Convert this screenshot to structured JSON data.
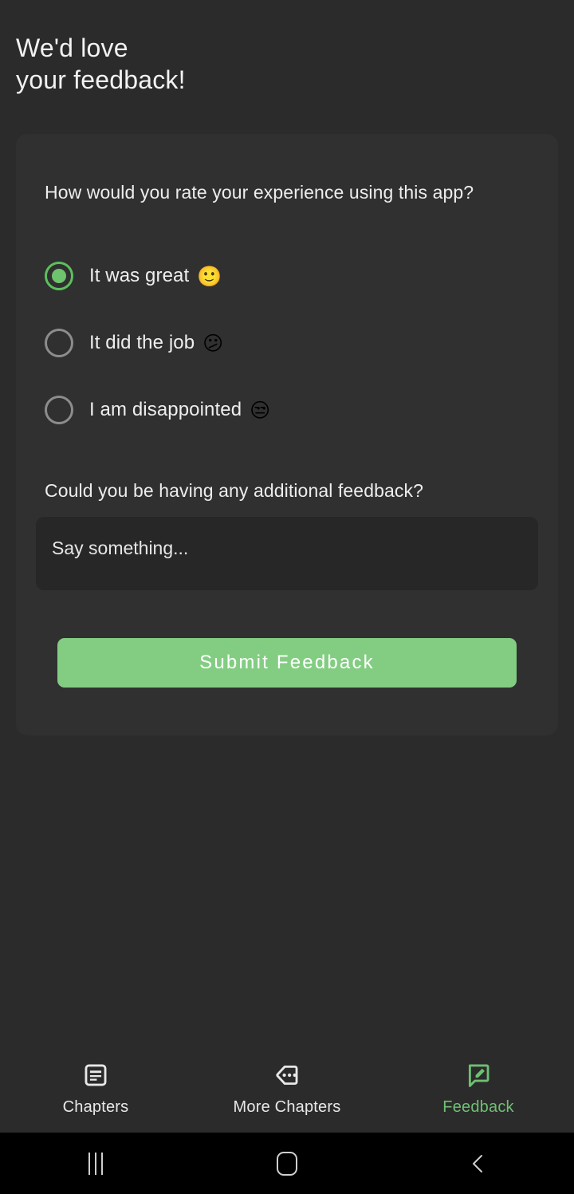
{
  "header": {
    "line1": "We'd love",
    "line2": "your feedback!"
  },
  "card": {
    "question_rating": "How would you rate your experience using this app?",
    "rating_options": [
      {
        "label": "It was great",
        "emoji": "🙂",
        "selected": true,
        "name": "rating-option-great"
      },
      {
        "label": "It did the job",
        "emoji": "😕",
        "selected": false,
        "name": "rating-option-did-the-job"
      },
      {
        "label": "I am disappointed",
        "emoji": "😒",
        "selected": false,
        "name": "rating-option-disappointed"
      }
    ],
    "question_additional": "Could you be having any additional feedback?",
    "textarea": {
      "placeholder": "Say something...",
      "value": ""
    },
    "submit_label": "Submit Feedback"
  },
  "bottom_nav": {
    "items": [
      {
        "label": "Chapters",
        "icon": "article-icon",
        "active": false
      },
      {
        "label": "More Chapters",
        "icon": "tag-more-icon",
        "active": false
      },
      {
        "label": "Feedback",
        "icon": "feedback-edit-icon",
        "active": true
      }
    ]
  },
  "system_nav": {
    "recents": "recents-icon",
    "home": "home-icon",
    "back": "back-icon"
  },
  "colors": {
    "page_background": "#2b2b2b",
    "card_background": "#303030",
    "field_background": "#272727",
    "accent_green": "#83cd83",
    "radio_selected": "#6ec46e",
    "tab_active": "#6fbf73",
    "text_primary": "#ededed"
  }
}
